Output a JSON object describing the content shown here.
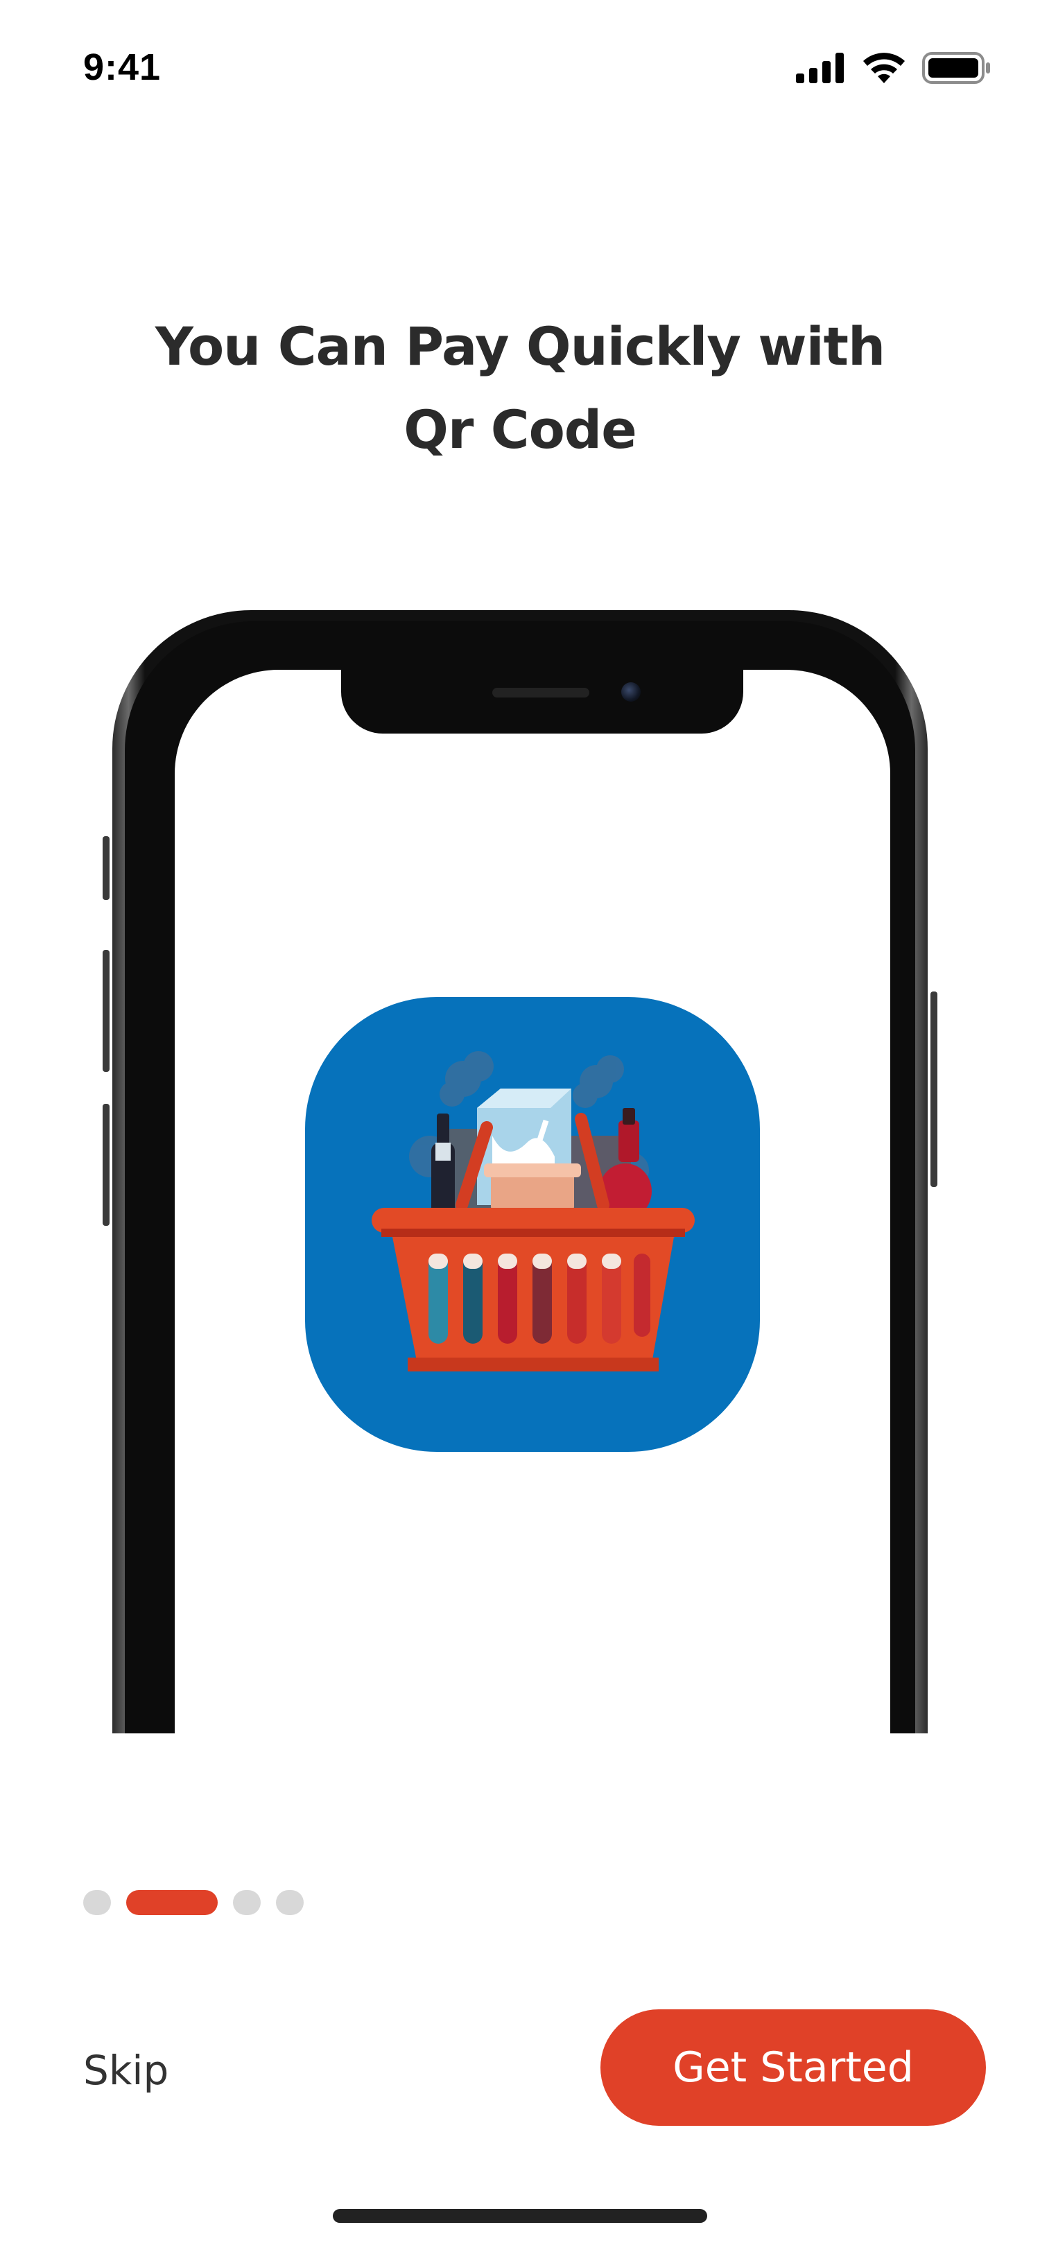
{
  "status_bar": {
    "time": "9:41",
    "icons": [
      "signal-icon",
      "wifi-icon",
      "battery-icon"
    ]
  },
  "onboarding": {
    "title_line1": "You Can Pay Quickly with",
    "title_line2": "Qr Code",
    "illustration": "grocery-basket-icon",
    "page_count": 4,
    "active_page": 2
  },
  "actions": {
    "skip_label": "Skip",
    "get_started_label": "Get Started"
  },
  "colors": {
    "accent": "#e04128",
    "icon_background": "#0672bb",
    "title_text": "#2b2b2b",
    "inactive_dot": "#d8d8d8"
  }
}
